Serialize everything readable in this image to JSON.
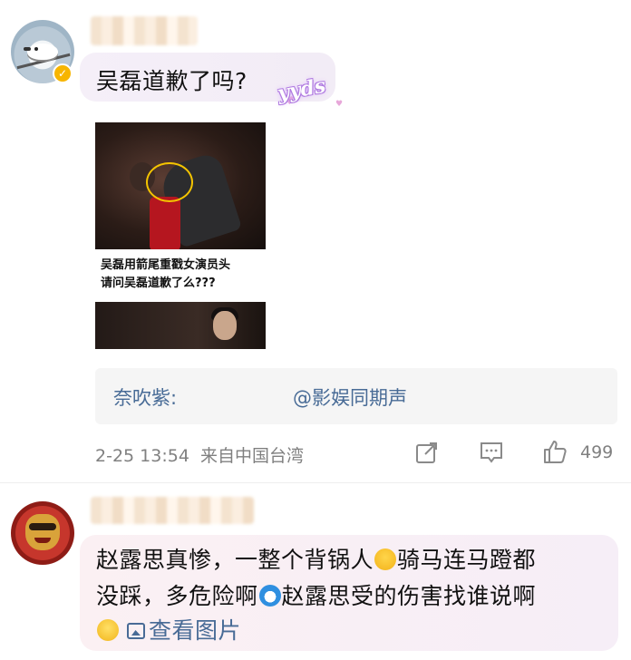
{
  "comment1": {
    "text": "吴磊道歉了吗?",
    "sticker": "yyds",
    "image_caption": [
      "吴磊用箭尾重戳女演员头",
      "请问吴磊道歉了么???"
    ],
    "repost_label": "奈吹紫:",
    "repost_source": "@影娱同期声",
    "timestamp": "2-25 13:54",
    "source": "来自中国台湾",
    "likes": "499",
    "icons": {
      "share": "share-icon",
      "comment": "comment-icon",
      "like": "thumbs-up-icon"
    }
  },
  "comment2": {
    "line1": "赵露思真惨，一整个背锅人",
    "line1b": "骑马连马蹬都",
    "line2a": "没踩，多危险啊",
    "line2b": "赵露思受的伤害找谁说啊",
    "view_image": "查看图片",
    "emojis": [
      "sweat-emoji",
      "doraemon-emoji",
      "smile-emoji"
    ]
  },
  "colors": {
    "link": "#486b96",
    "meta": "#808080",
    "verified": "#f7b500"
  }
}
